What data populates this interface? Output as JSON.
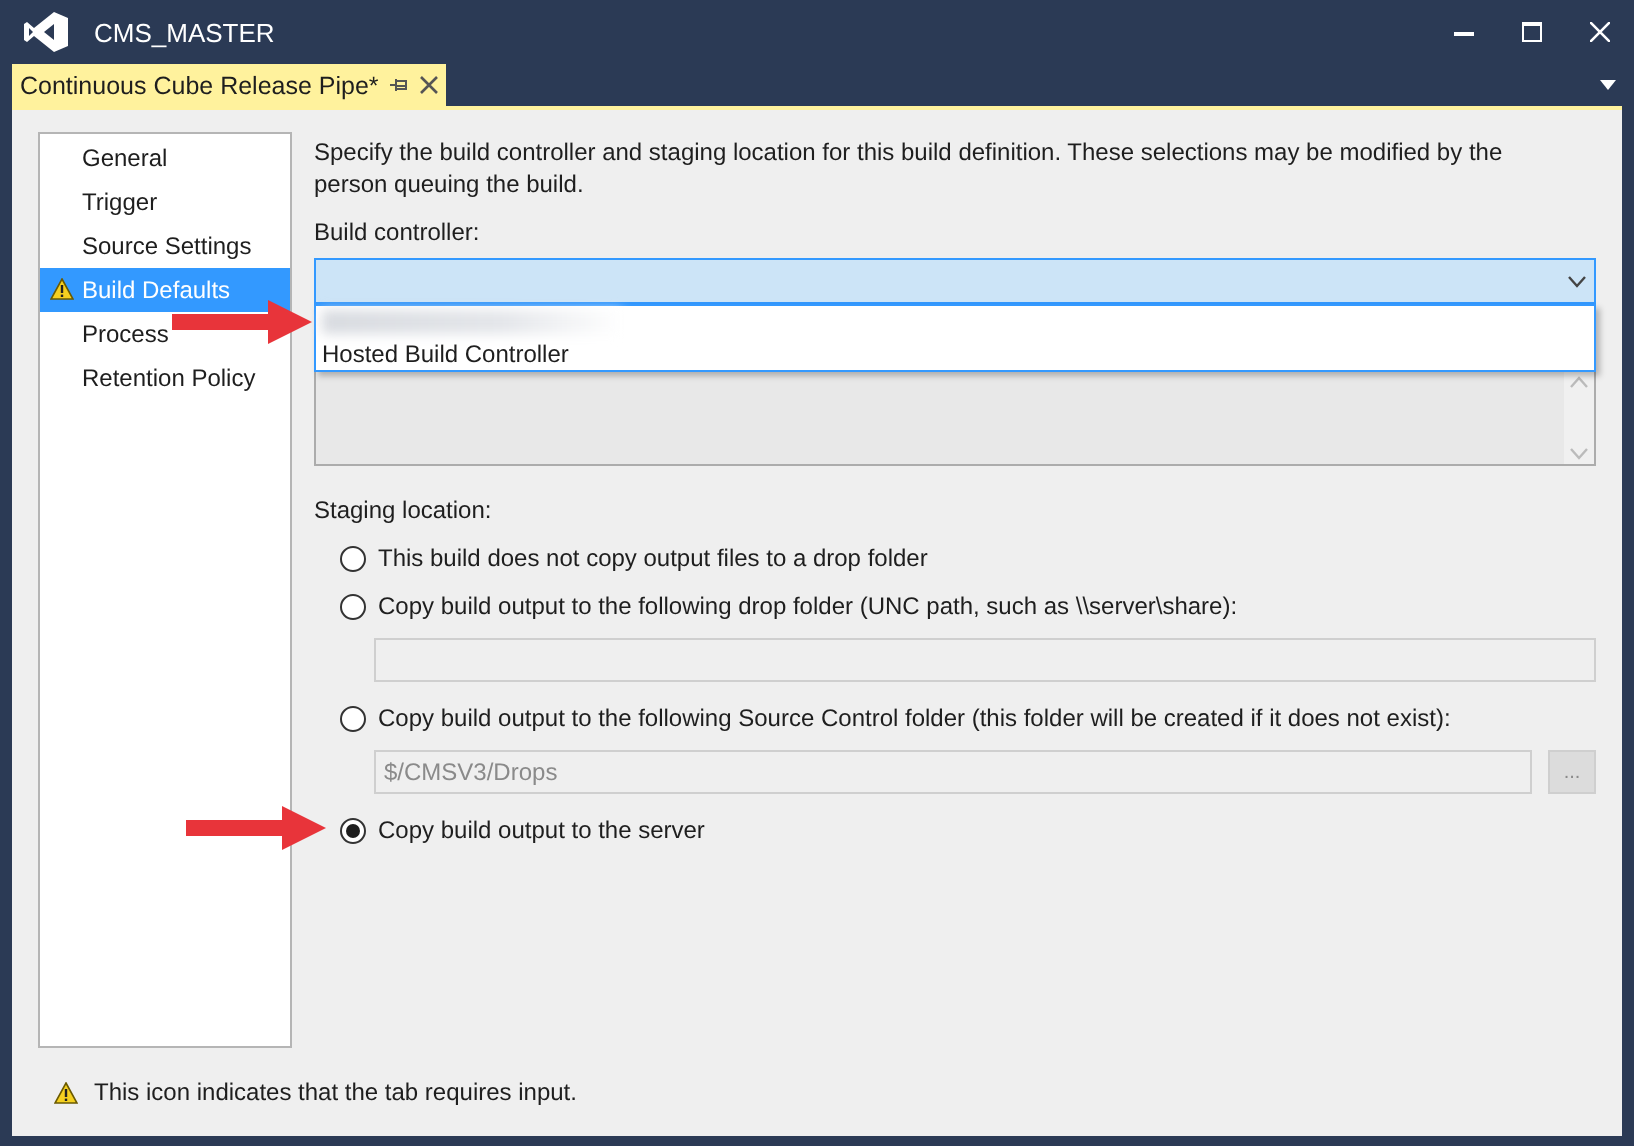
{
  "window": {
    "title": "CMS_MASTER"
  },
  "tabs": [
    {
      "label": "Continuous Cube Release Pipe*",
      "selected": true
    }
  ],
  "sidebar": {
    "items": [
      {
        "label": "General",
        "selected": false,
        "warning": false
      },
      {
        "label": "Trigger",
        "selected": false,
        "warning": false
      },
      {
        "label": "Source Settings",
        "selected": false,
        "warning": false
      },
      {
        "label": "Build Defaults",
        "selected": true,
        "warning": true
      },
      {
        "label": "Process",
        "selected": false,
        "warning": false
      },
      {
        "label": "Retention Policy",
        "selected": false,
        "warning": false
      }
    ]
  },
  "description": "Specify the build controller and staging location for this build definition. These selections may be modified by the person queuing the build.",
  "build_controller": {
    "label": "Build controller:",
    "expanded": true,
    "options": [
      {
        "kind": "redacted"
      },
      {
        "kind": "text",
        "label": "Hosted Build Controller"
      }
    ]
  },
  "staging": {
    "label": "Staging location:",
    "options": [
      {
        "kind": "plain",
        "label": "This build does not copy output files to a drop folder",
        "selected": false
      },
      {
        "kind": "field",
        "label": "Copy build output to the following drop folder (UNC path, such as \\\\server\\share):",
        "selected": false
      },
      {
        "kind": "browse",
        "label": "Copy build output to the following Source Control folder (this folder will be created if it does not exist):",
        "selected": false,
        "value": "$/CMSV3/Drops",
        "button": "..."
      },
      {
        "kind": "plain",
        "label": "Copy build output to the server",
        "selected": true
      }
    ]
  },
  "footer_note": "This icon indicates that the tab requires input."
}
